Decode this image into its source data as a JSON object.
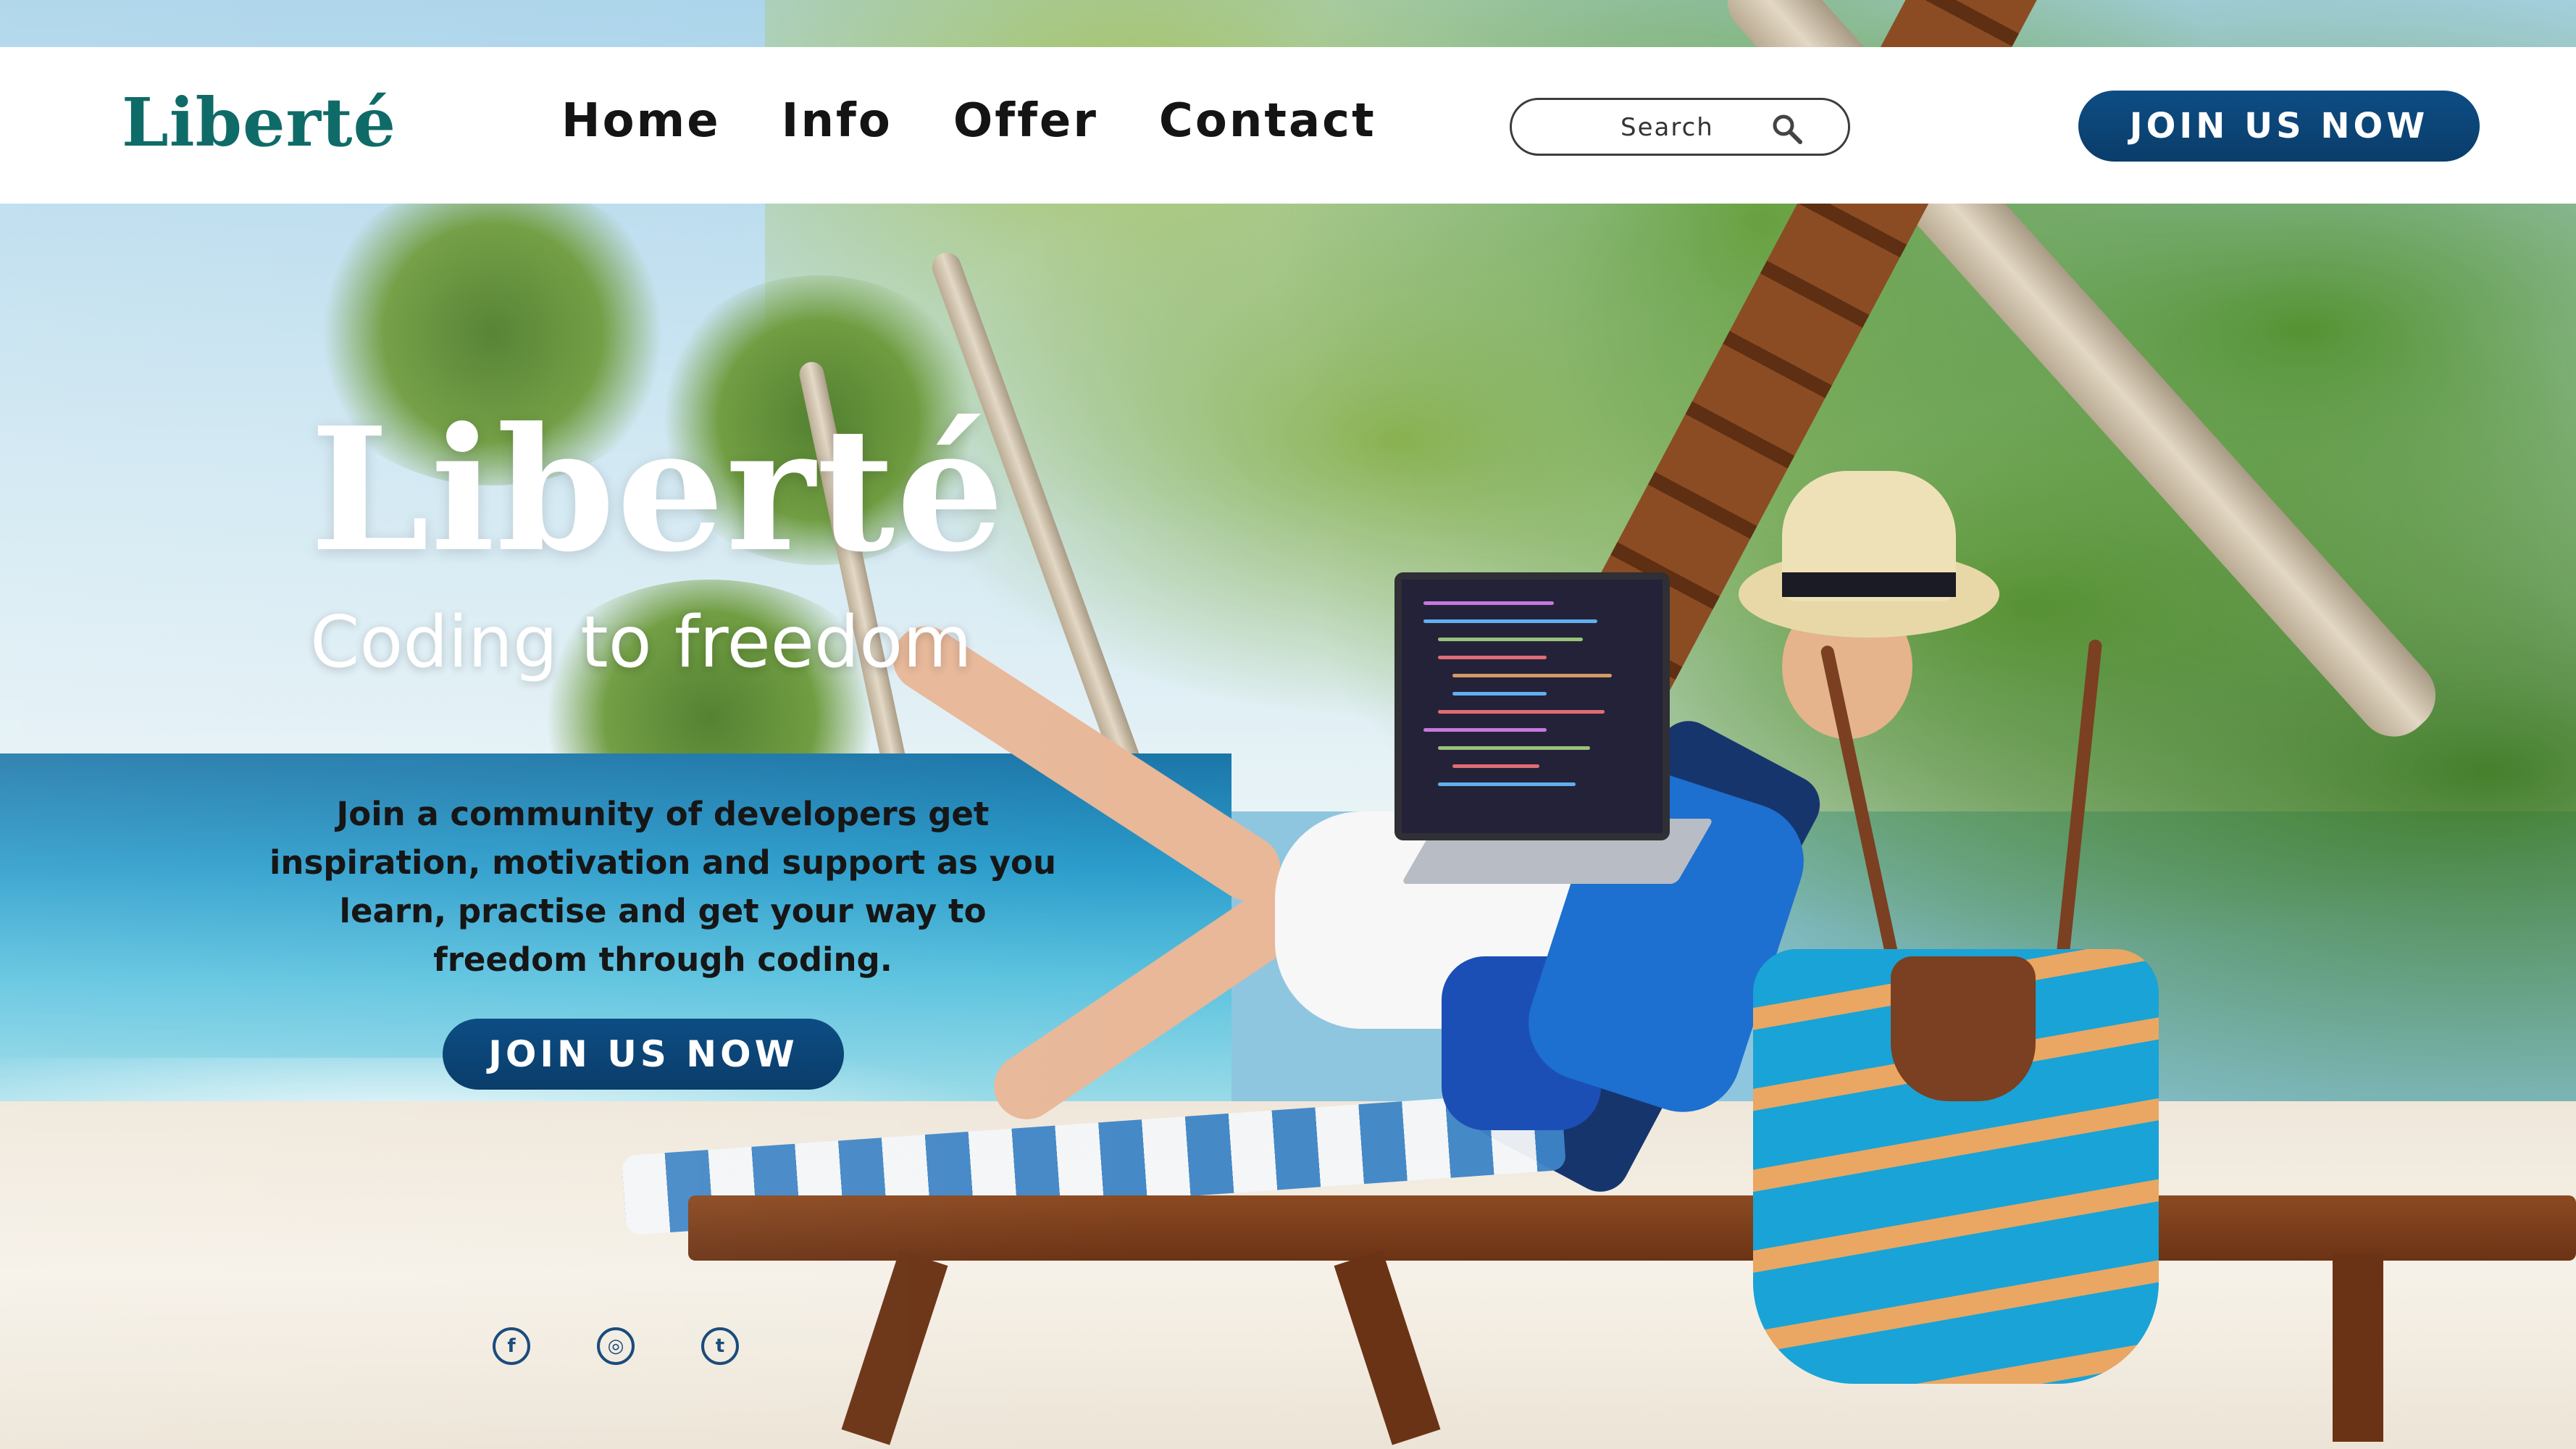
{
  "brand": {
    "logo": "Liberté",
    "accent_color": "#0f6b68"
  },
  "nav": {
    "items": [
      {
        "label": "Home"
      },
      {
        "label": "Info"
      },
      {
        "label": "Offer"
      },
      {
        "label": "Contact"
      }
    ]
  },
  "search": {
    "placeholder": "Search",
    "icon": "search-icon"
  },
  "header_cta": {
    "label": "JOIN US NOW",
    "color": "#0a3d6a"
  },
  "hero": {
    "title": "Liberté",
    "subtitle": "Coding to freedom",
    "description": "Join a community of developers get inspiration, motivation and support as you learn, practise and get your way to freedom through coding.",
    "cta_label": "JOIN US NOW"
  },
  "socials": [
    {
      "icon": "facebook-icon",
      "glyph": "f"
    },
    {
      "icon": "instagram-icon",
      "glyph": "◎"
    },
    {
      "icon": "twitter-icon",
      "glyph": "t"
    }
  ]
}
